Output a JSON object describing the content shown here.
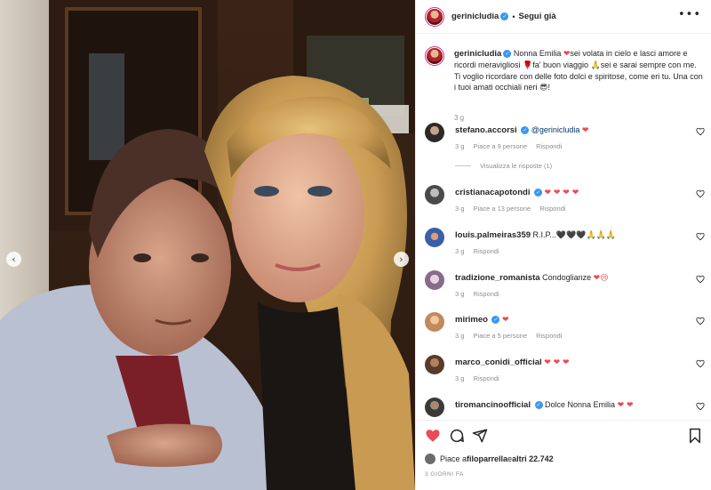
{
  "carousel": {
    "prev_icon": "chevron-left-icon",
    "next_icon": "chevron-right-icon"
  },
  "post": {
    "author": "gerinicludia",
    "author_verified": true,
    "separator": "•",
    "follow_label": "Segui già",
    "more_icon": "more-horizontal-icon"
  },
  "caption": {
    "username": "gerinicludia",
    "text_1": " Nonna Emilia ",
    "heart": "❤",
    "text_2": "sei volata in cielo e lasci amore e ricordi meravigliosi ",
    "rose": "🌹",
    "text_3": "fa' buon viaggio ",
    "pray": "🙏",
    "text_4": "sei e sarai sempre con me. Ti voglio ricordare con delle foto dolci e spiritose, come eri tu. Una con i tuoi amati occhiali neri ",
    "sunglasses": "😎",
    "text_5": "!",
    "age": "3 g"
  },
  "comments": [
    {
      "username": "stefano.accorsi",
      "verified": true,
      "mention": "@gerinicludia",
      "text": "",
      "emojis": "❤",
      "age": "3 g",
      "likes": "Piace a 9 persone",
      "reply": "Rispondi",
      "avatar_color": "#2a2a2a"
    },
    {
      "username": "cristianacapotondi",
      "verified": true,
      "mention": "",
      "text": "",
      "emojis": "❤ ❤ ❤ ❤",
      "age": "3 g",
      "likes": "Piace a 13 persone",
      "reply": "Rispondi",
      "avatar_color": "#4a4a4a"
    },
    {
      "username": "louis.palmeiras359",
      "verified": false,
      "mention": "",
      "text": "R.I.P...",
      "emojis": "🖤🖤🖤🙏🙏🙏",
      "age": "3 g",
      "likes": "",
      "reply": "Rispondi",
      "avatar_color": "#3b5fa8"
    },
    {
      "username": "tradizione_romanista",
      "verified": false,
      "mention": "",
      "text": "Condoglianze ",
      "emojis": "❤😢",
      "age": "3 g",
      "likes": "",
      "reply": "Rispondi",
      "avatar_color": "#8a6a8a"
    },
    {
      "username": "mirimeo",
      "verified": true,
      "mention": "",
      "text": "",
      "emojis": "❤",
      "age": "3 g",
      "likes": "Piace a 5 persone",
      "reply": "Rispondi",
      "avatar_color": "#c08a5a"
    },
    {
      "username": "marco_conidi_official",
      "verified": false,
      "mention": "",
      "text": "",
      "emojis": "❤ ❤ ❤",
      "age": "3 g",
      "likes": "",
      "reply": "Rispondi",
      "avatar_color": "#5a3a2a"
    },
    {
      "username": "tiromancinoofficial",
      "verified": true,
      "mention": "",
      "text": "Dolce Nonna Emilia ",
      "emojis": "❤ ❤",
      "age": "3 g",
      "likes": "",
      "reply": "Rispondi",
      "avatar_color": "#3a3a3a"
    }
  ],
  "view_replies": "Visualizza le risposte (1)",
  "actions": {
    "like_icon": "heart-filled-icon",
    "comment_icon": "comment-icon",
    "share_icon": "share-icon",
    "save_icon": "bookmark-icon",
    "likes_prefix": "Piace a ",
    "likes_user": "filoparrella",
    "likes_suffix_a": " e ",
    "likes_others": "altri 22.742",
    "timestamp": "3 GIORNI FA"
  },
  "colors": {
    "accent_like": "#ed4956",
    "verified": "#3897f0",
    "muted": "#8e8e8e"
  }
}
